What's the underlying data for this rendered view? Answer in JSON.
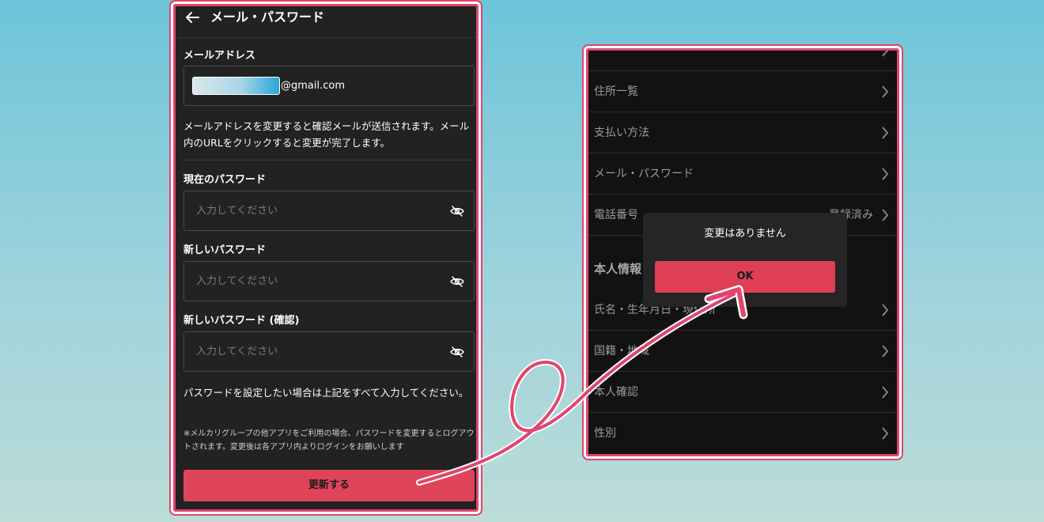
{
  "left_screen": {
    "title": "メール・パスワード",
    "email_label": "メールアドレス",
    "email_domain": "@gmail.com",
    "email_notice": "メールアドレスを変更すると確認メールが送信されます。メール内のURLをクリックすると変更が完了します。",
    "current_password_label": "現在のパスワード",
    "current_password_placeholder": "入力してください",
    "new_password_label": "新しいパスワード",
    "new_password_placeholder": "入力してください",
    "confirm_password_label": "新しいパスワード (確認)",
    "confirm_password_placeholder": "入力してください",
    "password_notice": "パスワードを設定したい場合は上記をすべて入力してください。",
    "app_notice": "※メルカリグループの他アプリをご利用の場合、パスワードを変更するとログアウトされます。変更後は各アプリ内よりログインをお願いします",
    "submit_label": "更新する"
  },
  "right_screen": {
    "rows_top": [
      {
        "label": "住所一覧"
      },
      {
        "label": "支払い方法"
      },
      {
        "label": "メール・パスワード"
      },
      {
        "label": "電話番号",
        "value": "登録済み"
      }
    ],
    "section_title": "本人情報",
    "rows_bottom": [
      {
        "label": "氏名・生年月日・現住所"
      },
      {
        "label": "国籍・地域"
      },
      {
        "label": "本人確認"
      },
      {
        "label": "性別"
      }
    ],
    "dialog": {
      "message": "変更はありません",
      "ok_label": "OK"
    }
  },
  "colors": {
    "accent": "#e0445a",
    "annotation_pink": "#e0456e",
    "screen_bg": "#222222",
    "page_bg_top": "#6cc4d9"
  }
}
